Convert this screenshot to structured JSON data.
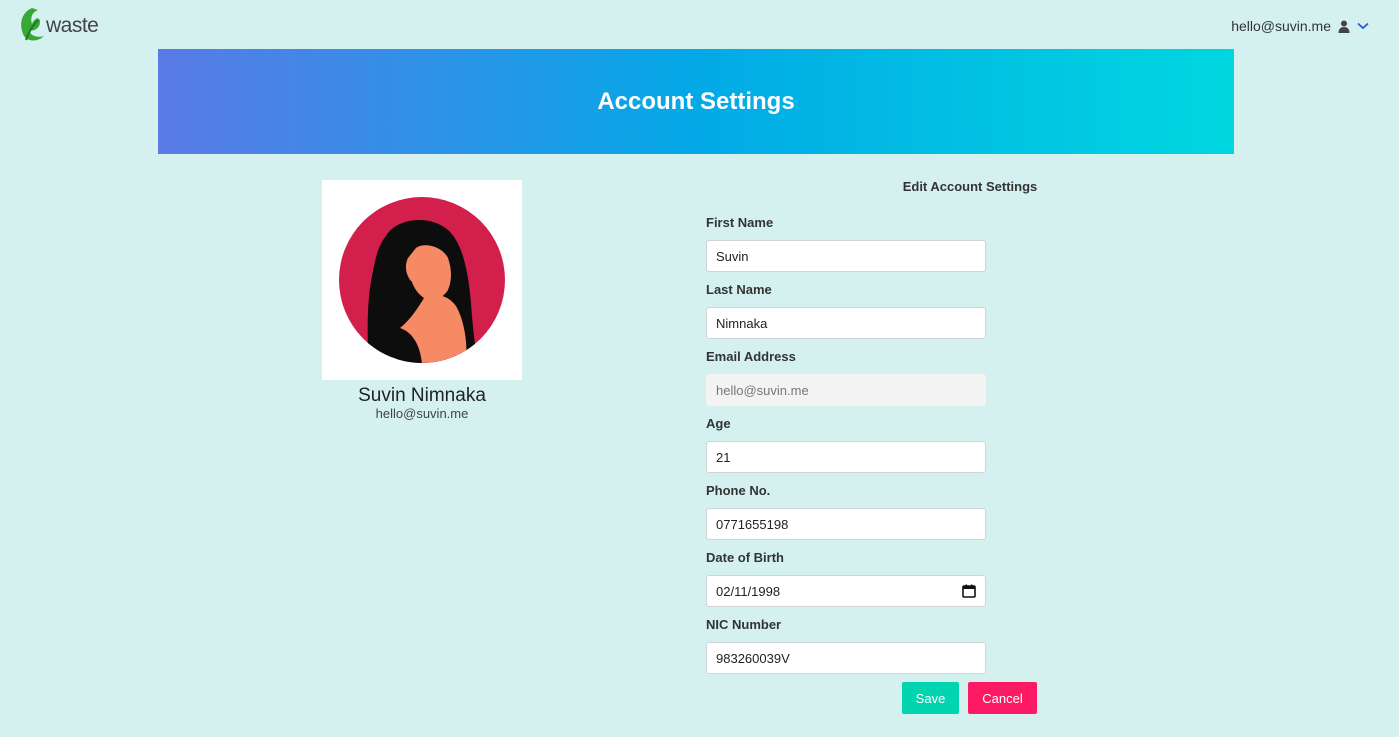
{
  "brand": {
    "name": "waste"
  },
  "user_menu": {
    "email": "hello@suvin.me",
    "icon": "person-icon",
    "toggle_icon": "chevron-down-icon"
  },
  "banner": {
    "title": "Account Settings"
  },
  "profile": {
    "name": "Suvin Nimnaka",
    "email": "hello@suvin.me"
  },
  "form": {
    "title": "Edit Account Settings",
    "fields": [
      {
        "label": "First Name",
        "value": "Suvin"
      },
      {
        "label": "Last Name",
        "value": "Nimnaka"
      },
      {
        "label": "Email Address",
        "value": "hello@suvin.me",
        "disabled": true
      },
      {
        "label": "Age",
        "value": "21"
      },
      {
        "label": "Phone No.",
        "value": "0771655198"
      },
      {
        "label": "Date of Birth",
        "value": "02/11/1998",
        "icon": "calendar-icon"
      },
      {
        "label": "NIC Number",
        "value": "983260039V"
      }
    ],
    "save_label": "Save",
    "cancel_label": "Cancel"
  },
  "colors": {
    "background": "#d4f1f0",
    "banner_start": "#5b7ae6",
    "banner_end": "#00d7e0",
    "save": "#00d5b0",
    "cancel": "#fb1a63",
    "avatar_circle": "#d21f4c"
  }
}
